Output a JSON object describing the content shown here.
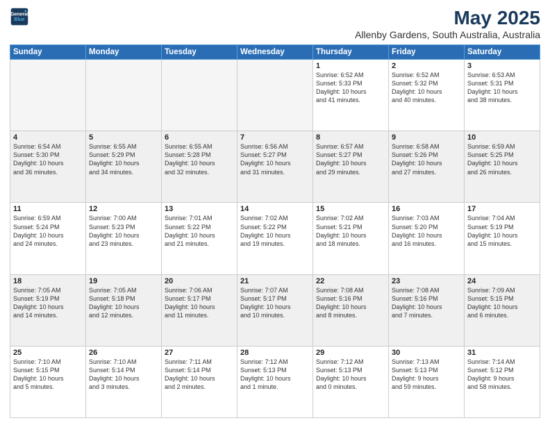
{
  "logo": {
    "line1": "General",
    "line2": "Blue"
  },
  "title": "May 2025",
  "subtitle": "Allenby Gardens, South Australia, Australia",
  "days_header": [
    "Sunday",
    "Monday",
    "Tuesday",
    "Wednesday",
    "Thursday",
    "Friday",
    "Saturday"
  ],
  "weeks": [
    [
      {
        "day": "",
        "info": ""
      },
      {
        "day": "",
        "info": ""
      },
      {
        "day": "",
        "info": ""
      },
      {
        "day": "",
        "info": ""
      },
      {
        "day": "1",
        "info": "Sunrise: 6:52 AM\nSunset: 5:33 PM\nDaylight: 10 hours\nand 41 minutes."
      },
      {
        "day": "2",
        "info": "Sunrise: 6:52 AM\nSunset: 5:32 PM\nDaylight: 10 hours\nand 40 minutes."
      },
      {
        "day": "3",
        "info": "Sunrise: 6:53 AM\nSunset: 5:31 PM\nDaylight: 10 hours\nand 38 minutes."
      }
    ],
    [
      {
        "day": "4",
        "info": "Sunrise: 6:54 AM\nSunset: 5:30 PM\nDaylight: 10 hours\nand 36 minutes."
      },
      {
        "day": "5",
        "info": "Sunrise: 6:55 AM\nSunset: 5:29 PM\nDaylight: 10 hours\nand 34 minutes."
      },
      {
        "day": "6",
        "info": "Sunrise: 6:55 AM\nSunset: 5:28 PM\nDaylight: 10 hours\nand 32 minutes."
      },
      {
        "day": "7",
        "info": "Sunrise: 6:56 AM\nSunset: 5:27 PM\nDaylight: 10 hours\nand 31 minutes."
      },
      {
        "day": "8",
        "info": "Sunrise: 6:57 AM\nSunset: 5:27 PM\nDaylight: 10 hours\nand 29 minutes."
      },
      {
        "day": "9",
        "info": "Sunrise: 6:58 AM\nSunset: 5:26 PM\nDaylight: 10 hours\nand 27 minutes."
      },
      {
        "day": "10",
        "info": "Sunrise: 6:59 AM\nSunset: 5:25 PM\nDaylight: 10 hours\nand 26 minutes."
      }
    ],
    [
      {
        "day": "11",
        "info": "Sunrise: 6:59 AM\nSunset: 5:24 PM\nDaylight: 10 hours\nand 24 minutes."
      },
      {
        "day": "12",
        "info": "Sunrise: 7:00 AM\nSunset: 5:23 PM\nDaylight: 10 hours\nand 23 minutes."
      },
      {
        "day": "13",
        "info": "Sunrise: 7:01 AM\nSunset: 5:22 PM\nDaylight: 10 hours\nand 21 minutes."
      },
      {
        "day": "14",
        "info": "Sunrise: 7:02 AM\nSunset: 5:22 PM\nDaylight: 10 hours\nand 19 minutes."
      },
      {
        "day": "15",
        "info": "Sunrise: 7:02 AM\nSunset: 5:21 PM\nDaylight: 10 hours\nand 18 minutes."
      },
      {
        "day": "16",
        "info": "Sunrise: 7:03 AM\nSunset: 5:20 PM\nDaylight: 10 hours\nand 16 minutes."
      },
      {
        "day": "17",
        "info": "Sunrise: 7:04 AM\nSunset: 5:19 PM\nDaylight: 10 hours\nand 15 minutes."
      }
    ],
    [
      {
        "day": "18",
        "info": "Sunrise: 7:05 AM\nSunset: 5:19 PM\nDaylight: 10 hours\nand 14 minutes."
      },
      {
        "day": "19",
        "info": "Sunrise: 7:05 AM\nSunset: 5:18 PM\nDaylight: 10 hours\nand 12 minutes."
      },
      {
        "day": "20",
        "info": "Sunrise: 7:06 AM\nSunset: 5:17 PM\nDaylight: 10 hours\nand 11 minutes."
      },
      {
        "day": "21",
        "info": "Sunrise: 7:07 AM\nSunset: 5:17 PM\nDaylight: 10 hours\nand 10 minutes."
      },
      {
        "day": "22",
        "info": "Sunrise: 7:08 AM\nSunset: 5:16 PM\nDaylight: 10 hours\nand 8 minutes."
      },
      {
        "day": "23",
        "info": "Sunrise: 7:08 AM\nSunset: 5:16 PM\nDaylight: 10 hours\nand 7 minutes."
      },
      {
        "day": "24",
        "info": "Sunrise: 7:09 AM\nSunset: 5:15 PM\nDaylight: 10 hours\nand 6 minutes."
      }
    ],
    [
      {
        "day": "25",
        "info": "Sunrise: 7:10 AM\nSunset: 5:15 PM\nDaylight: 10 hours\nand 5 minutes."
      },
      {
        "day": "26",
        "info": "Sunrise: 7:10 AM\nSunset: 5:14 PM\nDaylight: 10 hours\nand 3 minutes."
      },
      {
        "day": "27",
        "info": "Sunrise: 7:11 AM\nSunset: 5:14 PM\nDaylight: 10 hours\nand 2 minutes."
      },
      {
        "day": "28",
        "info": "Sunrise: 7:12 AM\nSunset: 5:13 PM\nDaylight: 10 hours\nand 1 minute."
      },
      {
        "day": "29",
        "info": "Sunrise: 7:12 AM\nSunset: 5:13 PM\nDaylight: 10 hours\nand 0 minutes."
      },
      {
        "day": "30",
        "info": "Sunrise: 7:13 AM\nSunset: 5:13 PM\nDaylight: 9 hours\nand 59 minutes."
      },
      {
        "day": "31",
        "info": "Sunrise: 7:14 AM\nSunset: 5:12 PM\nDaylight: 9 hours\nand 58 minutes."
      }
    ]
  ]
}
